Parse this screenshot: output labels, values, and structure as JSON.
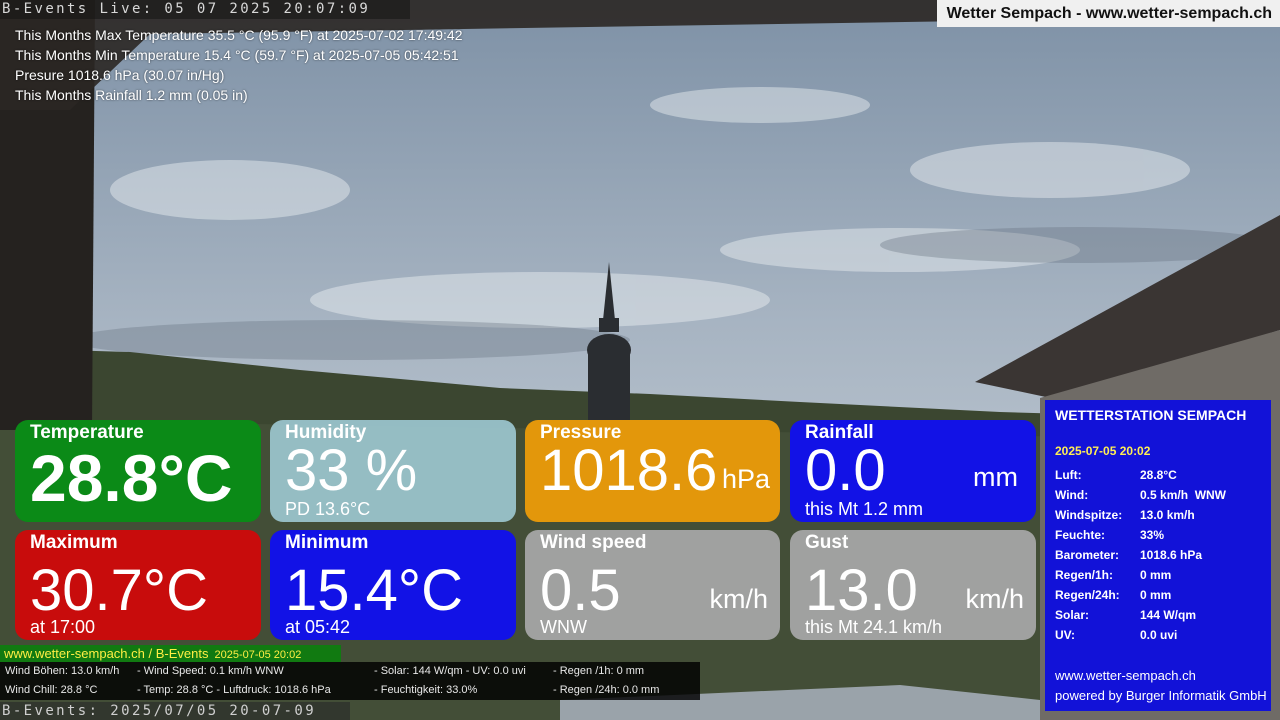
{
  "overlay": {
    "live_top": "B-Events Live: 05 07 2025 20:07:09",
    "site_title": "Wetter Sempach - www.wetter-sempach.ch",
    "live_bottom": "B-Events: 2025/07/05 20-07-09"
  },
  "stats": [
    "This Months Max Temperature 35.5 °C (95.9 °F) at 2025-07-02 17:49:42",
    "This Months Min Temperature 15.4 °C (59.7 °F) at 2025-07-05 05:42:51",
    "Presure 1018.6 hPa (30.07 in/Hg)",
    "This Months Rainfall 1.2 mm (0.05 in)"
  ],
  "tiles": {
    "temperature": {
      "title": "Temperature",
      "value": "28.8°C",
      "color": "#0b8a17"
    },
    "humidity": {
      "title": "Humidity",
      "value": "33 %",
      "sub": "PD 13.6°C",
      "color": "#a0cdd7"
    },
    "pressure": {
      "title": "Pressure",
      "value": "1018.6",
      "unit": "hPa",
      "color": "#e3970b"
    },
    "rainfall": {
      "title": "Rainfall",
      "value": "0.0",
      "unit": "mm",
      "sub": "this Mt 1.2 mm",
      "color": "#1212e6"
    },
    "maximum": {
      "title": "Maximum",
      "value": "30.7°C",
      "sub": "at 17:00",
      "color": "#c80c0c"
    },
    "minimum": {
      "title": "Minimum",
      "value": "15.4°C",
      "sub": "at 05:42",
      "color": "#1212e6"
    },
    "windspeed": {
      "title": "Wind speed",
      "value": "0.5",
      "unit": "km/h",
      "sub": "WNW",
      "color": "#a8a8a8"
    },
    "gust": {
      "title": "Gust",
      "value": "13.0",
      "unit": "km/h",
      "sub": "this Mt 24.1 km/h",
      "color": "#a8a8a8"
    }
  },
  "panel": {
    "title": "WETTERSTATION SEMPACH",
    "datetime": "2025-07-05 20:02",
    "rows": [
      {
        "k": "Luft:",
        "v": "28.8°C"
      },
      {
        "k": "Wind:",
        "v": "0.5 km/h  WNW"
      },
      {
        "k": "Windspitze:",
        "v": "13.0 km/h"
      },
      {
        "k": "Feuchte:",
        "v": "33%"
      },
      {
        "k": "Barometer:",
        "v": "1018.6 hPa"
      },
      {
        "k": "Regen/1h:",
        "v": "0 mm"
      },
      {
        "k": "Regen/24h:",
        "v": "0 mm"
      },
      {
        "k": "Solar:",
        "v": "144 W/qm"
      },
      {
        "k": "UV:",
        "v": "0.0 uvi"
      }
    ],
    "footer1": "www.wetter-sempach.ch",
    "footer2": "powered by Burger Informatik GmbH"
  },
  "bottom": {
    "site": "www.wetter-sempach.ch / B-Events",
    "date": "2025-07-05 20:02",
    "ticker": {
      "wind_gusts": "Wind Böhen: 13.0 km/h",
      "wind_speed": "- Wind Speed: 0.1 km/h WNW",
      "solar_uv": "- Solar: 144 W/qm   - UV: 0.0 uvi",
      "rain_1h": "- Regen /1h:   0 mm",
      "wind_chill": "Wind Chill: 28.8 °C",
      "temp_pressure": "- Temp: 28.8 °C  - Luftdruck: 1018.6 hPa",
      "humidity": "- Feuchtigkeit: 33.0%",
      "rain_24h": "- Regen /24h: 0.0 mm"
    }
  }
}
